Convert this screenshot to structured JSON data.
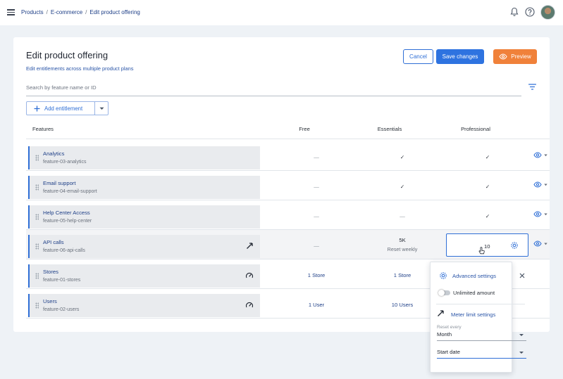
{
  "breadcrumb": [
    "Products",
    "E-commerce",
    "Edit product offering"
  ],
  "header": {
    "title": "Edit product offering",
    "subtitle": "Edit entitlements across multiple product plans",
    "cancel_label": "Cancel",
    "save_label": "Save changes",
    "preview_label": "Preview"
  },
  "search": {
    "placeholder": "Search by feature name or ID"
  },
  "add_entitlement_label": "Add entitlement",
  "columns": {
    "features": "Features",
    "plans": [
      "Free",
      "Essentials",
      "Professional"
    ]
  },
  "rows": [
    {
      "name": "Analytics",
      "id": "feature-03-analytics",
      "values": [
        "—",
        "✓",
        "✓"
      ]
    },
    {
      "name": "Email support",
      "id": "feature-04-email-support",
      "values": [
        "—",
        "✓",
        "✓"
      ]
    },
    {
      "name": "Help Center Access",
      "id": "feature-05-help-center",
      "values": [
        "—",
        "—",
        "✓"
      ]
    },
    {
      "name": "API calls",
      "id": "feature-06-api-calls",
      "values": [
        "—",
        "5K",
        "10"
      ],
      "essentials_sub": "Reset weekly",
      "feature_icon": "meter-icon"
    },
    {
      "name": "Stores",
      "id": "feature-01-stores",
      "values": [
        "1 Store",
        "1 Store",
        ""
      ],
      "feature_icon": "gauge-icon"
    },
    {
      "name": "Users",
      "id": "feature-02-users",
      "values": [
        "1 User",
        "10 Users",
        ""
      ],
      "feature_icon": "gauge-icon"
    }
  ],
  "popover": {
    "title": "Advanced settings",
    "unlimited_label": "Unlimited amount",
    "meter_label": "Meter limit settings",
    "reset_label": "Reset every",
    "reset_value": "Month",
    "start_value": "Start date"
  },
  "colors": {
    "primary": "#2e73e0",
    "preview": "#f0813a",
    "link": "#1e3f87"
  }
}
